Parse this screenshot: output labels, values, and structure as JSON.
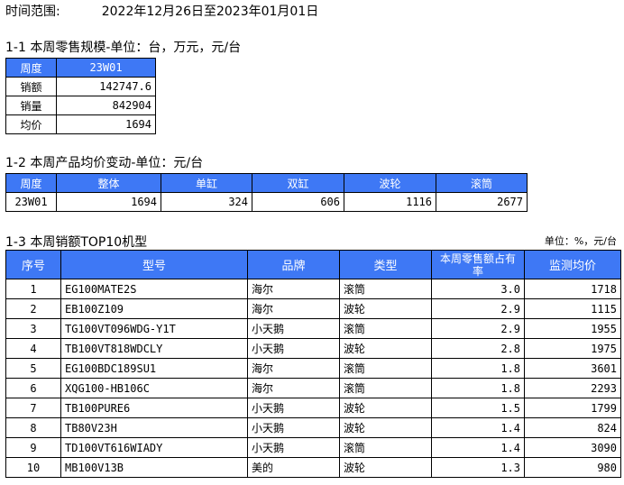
{
  "date_range": {
    "label": "时间范围:",
    "value": "2022年12月26日至2023年01月01日"
  },
  "section1": {
    "title": "1-1 本周零售规模-单位：台，万元，元/台",
    "header": {
      "label": "周度",
      "value": "23W01"
    },
    "rows": [
      {
        "label": "销额",
        "value": "142747.6"
      },
      {
        "label": "销量",
        "value": "842904"
      },
      {
        "label": "均价",
        "value": "1694"
      }
    ]
  },
  "section2": {
    "title": "1-2 本周产品均价变动-单位：元/台",
    "headers": [
      "周度",
      "整体",
      "单缸",
      "双缸",
      "波轮",
      "滚筒"
    ],
    "row": [
      "23W01",
      "1694",
      "324",
      "606",
      "1116",
      "2677"
    ]
  },
  "section3": {
    "title": "1-3 本周销额TOP10机型",
    "unit_note": "单位：%，元/台",
    "headers": [
      "序号",
      "型号",
      "品牌",
      "类型",
      "本周零售额占有率",
      "监测均价"
    ],
    "rows": [
      [
        "1",
        "EG100MATE2S",
        "海尔",
        "滚筒",
        "3.0",
        "1718"
      ],
      [
        "2",
        "EB100Z109",
        "海尔",
        "波轮",
        "2.9",
        "1115"
      ],
      [
        "3",
        "TG100VT096WDG-Y1T",
        "小天鹅",
        "滚筒",
        "2.9",
        "1955"
      ],
      [
        "4",
        "TB100VT818WDCLY",
        "小天鹅",
        "波轮",
        "2.8",
        "1975"
      ],
      [
        "5",
        "EG100BDC189SU1",
        "海尔",
        "滚筒",
        "1.8",
        "3601"
      ],
      [
        "6",
        "XQG100-HB106C",
        "海尔",
        "滚筒",
        "1.8",
        "2293"
      ],
      [
        "7",
        "TB100PURE6",
        "小天鹅",
        "波轮",
        "1.5",
        "1799"
      ],
      [
        "8",
        "TB80V23H",
        "小天鹅",
        "波轮",
        "1.4",
        "824"
      ],
      [
        "9",
        "TD100VT616WIADY",
        "小天鹅",
        "滚筒",
        "1.4",
        "3090"
      ],
      [
        "10",
        "MB100V13B",
        "美的",
        "波轮",
        "1.3",
        "980"
      ]
    ]
  }
}
